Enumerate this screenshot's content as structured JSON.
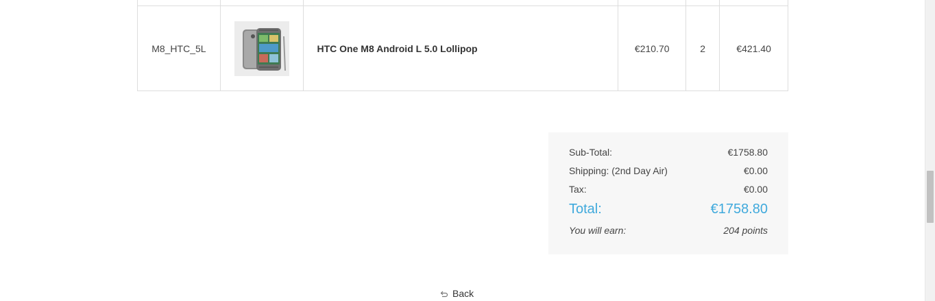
{
  "order": {
    "items": [
      {
        "sku": "M8_HTC_5L",
        "image_alt": "HTC One M8 phone",
        "name": "HTC One M8 Android L 5.0 Lollipop",
        "price": "€210.70",
        "quantity": "2",
        "total": "€421.40"
      }
    ]
  },
  "totals": {
    "subtotal_label": "Sub-Total:",
    "subtotal_value": "€1758.80",
    "shipping_label": "Shipping: (2nd Day Air)",
    "shipping_value": "€0.00",
    "tax_label": "Tax:",
    "tax_value": "€0.00",
    "total_label": "Total:",
    "total_value": "€1758.80",
    "earn_label": "You will earn:",
    "earn_value": "204 points",
    "accent_color": "#3fa9dc"
  },
  "back": {
    "label": "Back",
    "icon": "return-arrow-icon"
  }
}
